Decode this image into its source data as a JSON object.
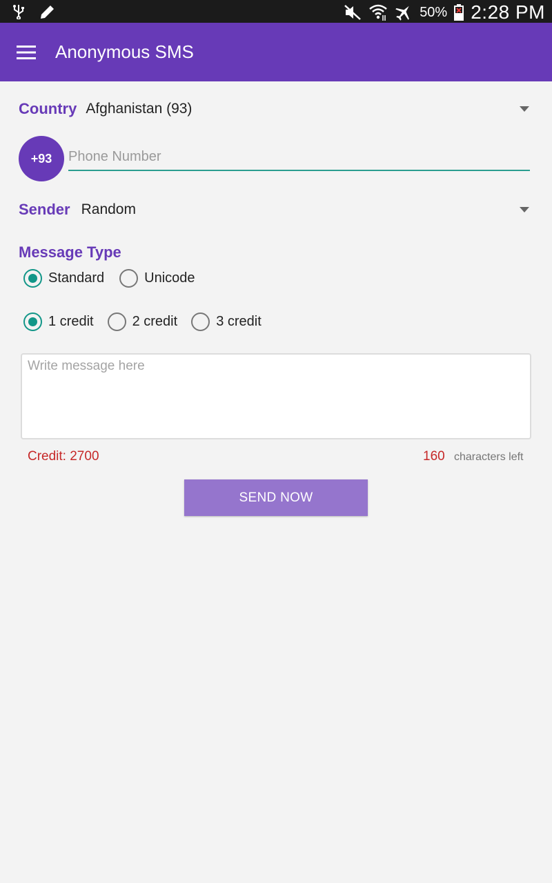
{
  "status_bar": {
    "icons": [
      "usb-icon",
      "edit-icon",
      "mute-icon",
      "wifi-icon",
      "airplane-icon",
      "battery-icon"
    ],
    "battery": "50%",
    "time": "2:28 PM"
  },
  "toolbar": {
    "menu_icon": "hamburger-menu-icon",
    "title": "Anonymous SMS",
    "color": "#673ab7"
  },
  "country": {
    "label": "Country",
    "selected": "Afghanistan (93)"
  },
  "phone": {
    "prefix": "+93",
    "value": "",
    "placeholder": "Phone Number"
  },
  "sender": {
    "label": "Sender",
    "selected": "Random"
  },
  "message_type": {
    "label": "Message Type",
    "options": [
      {
        "label": "Standard",
        "checked": true
      },
      {
        "label": "Unicode",
        "checked": false
      }
    ]
  },
  "credit_options": [
    {
      "label": "1 credit",
      "checked": true
    },
    {
      "label": "2 credit",
      "checked": false
    },
    {
      "label": "3 credit",
      "checked": false
    }
  ],
  "message": {
    "value": "",
    "placeholder": "Write message here"
  },
  "footer": {
    "credit": "Credit: 2700",
    "chars_left": "160",
    "chars_left_label": "characters left"
  },
  "send_button": "SEND NOW",
  "colors": {
    "primary": "#673ab7",
    "accent": "#129688",
    "button": "#9575cd",
    "error_text": "#c62828"
  }
}
